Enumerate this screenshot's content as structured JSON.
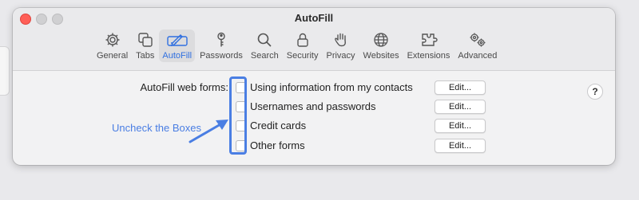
{
  "window": {
    "title": "AutoFill"
  },
  "toolbar": {
    "items": [
      {
        "label": "General",
        "icon": "gear-icon",
        "active": false
      },
      {
        "label": "Tabs",
        "icon": "tabs-icon",
        "active": false
      },
      {
        "label": "AutoFill",
        "icon": "autofill-pencil-icon",
        "active": true
      },
      {
        "label": "Passwords",
        "icon": "key-icon",
        "active": false
      },
      {
        "label": "Search",
        "icon": "magnifier-icon",
        "active": false
      },
      {
        "label": "Security",
        "icon": "lock-icon",
        "active": false
      },
      {
        "label": "Privacy",
        "icon": "hand-icon",
        "active": false
      },
      {
        "label": "Websites",
        "icon": "globe-icon",
        "active": false
      },
      {
        "label": "Extensions",
        "icon": "puzzle-icon",
        "active": false
      },
      {
        "label": "Advanced",
        "icon": "gears-icon",
        "active": false
      }
    ],
    "active_color": "#2f6fe0"
  },
  "autofill": {
    "section_label": "AutoFill web forms:",
    "options": [
      {
        "label": "Using information from my contacts",
        "checked": false,
        "edit_label": "Edit..."
      },
      {
        "label": "Usernames and passwords",
        "checked": false,
        "edit_label": "Edit..."
      },
      {
        "label": "Credit cards",
        "checked": false,
        "edit_label": "Edit..."
      },
      {
        "label": "Other forms",
        "checked": false,
        "edit_label": "Edit..."
      }
    ]
  },
  "help": {
    "label": "?"
  },
  "annotation": {
    "text": "Uncheck the Boxes",
    "color": "#4a7ee3"
  }
}
